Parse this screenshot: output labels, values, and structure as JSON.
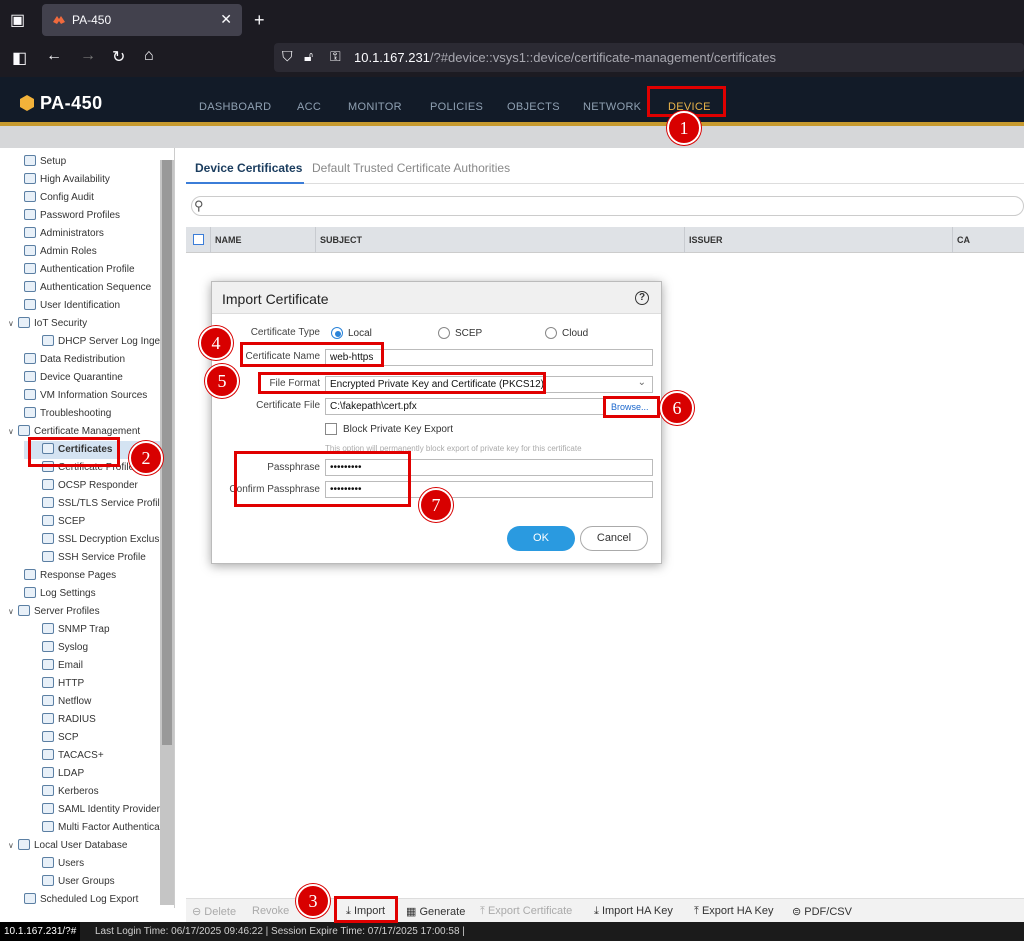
{
  "browser": {
    "tab_title": "PA-450",
    "tab_close": "✕",
    "new_tab": "+",
    "url_host": "10.1.167.231",
    "url_path": "/?#device::vsys1::device/certificate-management/certificates"
  },
  "app": {
    "logo": "PA-450",
    "nav": [
      "DASHBOARD",
      "ACC",
      "MONITOR",
      "POLICIES",
      "OBJECTS",
      "NETWORK",
      "DEVICE"
    ],
    "active_nav": "DEVICE"
  },
  "sidebar": {
    "items": [
      {
        "label": "Setup"
      },
      {
        "label": "High Availability"
      },
      {
        "label": "Config Audit"
      },
      {
        "label": "Password Profiles"
      },
      {
        "label": "Administrators"
      },
      {
        "label": "Admin Roles"
      },
      {
        "label": "Authentication Profile"
      },
      {
        "label": "Authentication Sequence"
      },
      {
        "label": "User Identification"
      },
      {
        "label": "IoT Security"
      },
      {
        "label": "DHCP Server Log Ingest"
      },
      {
        "label": "Data Redistribution"
      },
      {
        "label": "Device Quarantine"
      },
      {
        "label": "VM Information Sources"
      },
      {
        "label": "Troubleshooting"
      },
      {
        "label": "Certificate Management"
      },
      {
        "label": "Certificates"
      },
      {
        "label": "Certificate Profile"
      },
      {
        "label": "OCSP Responder"
      },
      {
        "label": "SSL/TLS Service Profile"
      },
      {
        "label": "SCEP"
      },
      {
        "label": "SSL Decryption Exclusion"
      },
      {
        "label": "SSH Service Profile"
      },
      {
        "label": "Response Pages"
      },
      {
        "label": "Log Settings"
      },
      {
        "label": "Server Profiles"
      },
      {
        "label": "SNMP Trap"
      },
      {
        "label": "Syslog"
      },
      {
        "label": "Email"
      },
      {
        "label": "HTTP"
      },
      {
        "label": "Netflow"
      },
      {
        "label": "RADIUS"
      },
      {
        "label": "SCP"
      },
      {
        "label": "TACACS+"
      },
      {
        "label": "LDAP"
      },
      {
        "label": "Kerberos"
      },
      {
        "label": "SAML Identity Provider"
      },
      {
        "label": "Multi Factor Authentication"
      },
      {
        "label": "Local User Database"
      },
      {
        "label": "Users"
      },
      {
        "label": "User Groups"
      },
      {
        "label": "Scheduled Log Export"
      }
    ]
  },
  "main": {
    "tabs": [
      "Device Certificates",
      "Default Trusted Certificate Authorities"
    ],
    "columns": [
      "NAME",
      "SUBJECT",
      "ISSUER",
      "CA"
    ]
  },
  "dialog": {
    "title": "Import Certificate",
    "help": "?",
    "cert_type_label": "Certificate Type",
    "cert_type_options": [
      "Local",
      "SCEP",
      "Cloud"
    ],
    "cert_type_selected": "Local",
    "cert_name_label": "Certificate Name",
    "cert_name_value": "web-https",
    "file_format_label": "File Format",
    "file_format_value": "Encrypted Private Key and Certificate (PKCS12)",
    "cert_file_label": "Certificate File",
    "cert_file_value": "C:\\fakepath\\cert.pfx",
    "browse": "Browse...",
    "block_key_label": "Block Private Key Export",
    "block_key_hint": "This option will permanently block export of private key for this certificate",
    "passphrase_label": "Passphrase",
    "passphrase_value": "•••••••••",
    "confirm_label": "Confirm Passphrase",
    "confirm_value": "•••••••••",
    "ok": "OK",
    "cancel": "Cancel"
  },
  "bottom_actions": [
    "Delete",
    "Revoke",
    "Import",
    "Generate",
    "Export Certificate",
    "Import HA Key",
    "Export HA Key",
    "PDF/CSV"
  ],
  "status": {
    "ip": "10.1.167.231/?#",
    "text": "Last Login Time: 06/17/2025 09:46:22 | Session Expire Time: 07/17/2025 17:00:58 |"
  },
  "callouts": [
    "1",
    "2",
    "3",
    "4",
    "5",
    "6",
    "7"
  ],
  "colors": {
    "callout": "#d80000",
    "accent": "#e8b34a",
    "link": "#1a66cc",
    "ok_button": "#2a9ae0"
  }
}
